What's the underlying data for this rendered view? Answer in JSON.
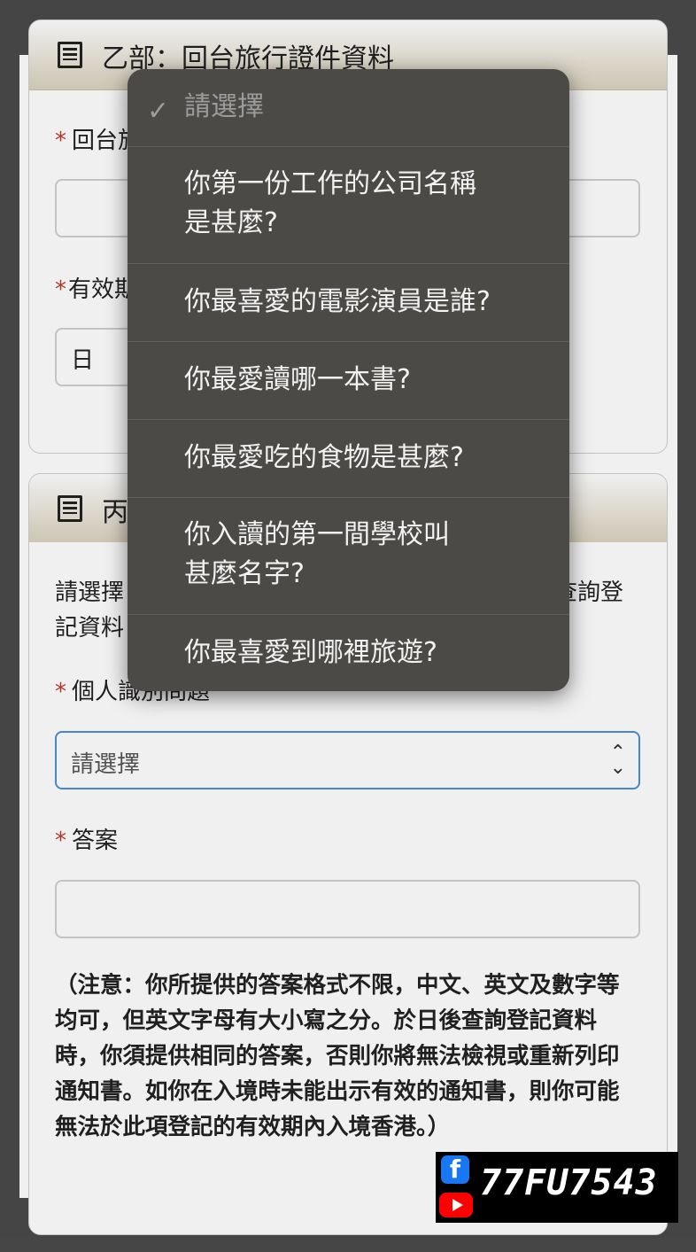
{
  "section_b": {
    "title": "乙部：回台旅行證件資料",
    "label_doc": "回台旅",
    "label_validity": "有效期",
    "day_value": "日"
  },
  "section_c": {
    "title": "丙",
    "intro_left_1": "請選擇",
    "intro_right_1": "查詢登",
    "intro_left_2": "記資料",
    "question_label": "個人識別問題",
    "question_placeholder": "請選擇",
    "answer_label": "答案",
    "note": "（注意：你所提供的答案格式不限，中文、英文及數字等均可，但英文字母有大小寫之分。於日後查詢登記資料時，你須提供相同的答案，否則你將無法檢視或重新列印通知書。如你在入境時未能出示有效的通知書，則你可能無法於此項登記的有效期內入境香港。）"
  },
  "required_mark": "*",
  "dropdown": {
    "selected": "請選擇",
    "options": [
      {
        "line1": "你第一份工作的公司名稱",
        "line2": "是甚麼?"
      },
      {
        "line1": "你最喜愛的電影演員是誰?",
        "line2": ""
      },
      {
        "line1": "你最愛讀哪一本書?",
        "line2": ""
      },
      {
        "line1": "你最愛吃的食物是甚麼?",
        "line2": ""
      },
      {
        "line1": "你入讀的第一間學校叫",
        "line2": "甚麼名字?"
      },
      {
        "line1": "你最喜愛到哪裡旅遊?",
        "line2": ""
      }
    ]
  },
  "watermark": {
    "fb_letter": "f",
    "handle": "77FU7543"
  }
}
